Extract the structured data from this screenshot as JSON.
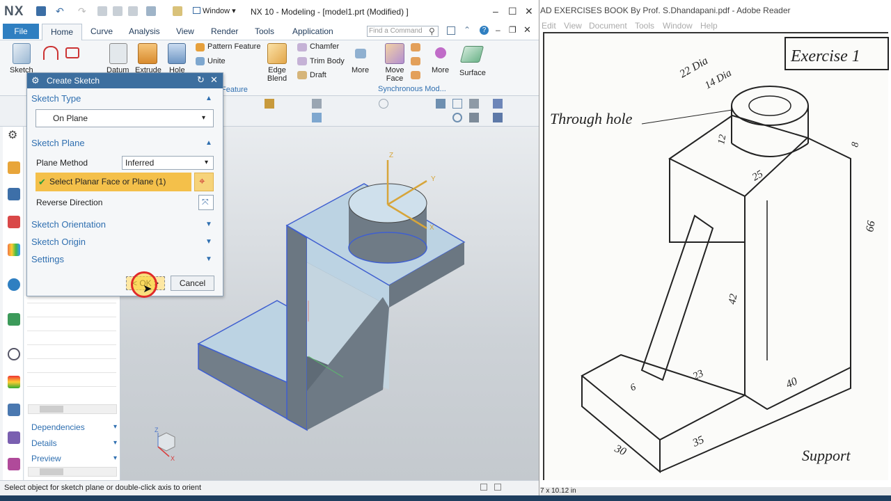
{
  "nx": {
    "logo": "NX",
    "window_title": "NX 10 - Modeling - [model1.prt (Modified) ]",
    "window_menu": "Window ▾",
    "find_command_placeholder": "Find a Command",
    "tabs": [
      "File",
      "Home",
      "Curve",
      "Analysis",
      "View",
      "Render",
      "Tools",
      "Application"
    ],
    "ribbon": {
      "sketch": "Sketch",
      "datum": "Datum",
      "extrude": "Extrude",
      "hole": "Hole",
      "pattern_feature": "Pattern Feature",
      "unite": "Unite",
      "edge_blend": "Edge Blend",
      "chamfer": "Chamfer",
      "trim_body": "Trim Body",
      "draft": "Draft",
      "more1": "More",
      "move_face": "Move Face",
      "more2": "More",
      "surface": "Surface",
      "group_feature": "Feature",
      "group_sync": "Synchronous Mod..."
    },
    "dialog": {
      "title": "Create Sketch",
      "sketch_type_header": "Sketch Type",
      "sketch_type_value": "On Plane",
      "sketch_plane_header": "Sketch Plane",
      "plane_method_label": "Plane Method",
      "plane_method_value": "Inferred",
      "select_face_label": "Select Planar Face or Plane (1)",
      "reverse_direction_label": "Reverse Direction",
      "sketch_orientation": "Sketch Orientation",
      "sketch_origin": "Sketch Origin",
      "settings": "Settings",
      "ok_label": "< OK >",
      "cancel_label": "Cancel"
    },
    "navigator": {
      "dependencies": "Dependencies",
      "details": "Details",
      "preview": "Preview"
    },
    "status_text": "Select object for sketch plane or double-click axis to orient",
    "axes": {
      "z": "Z",
      "y": "Y",
      "x": "X"
    }
  },
  "pdf": {
    "title": "AD EXERCISES BOOK By Prof. S.Dhandapani.pdf - Adobe Reader",
    "menu": [
      "Edit",
      "View",
      "Document",
      "Tools",
      "Window",
      "Help"
    ],
    "page_size": "7 x 10.12 in",
    "drawing": {
      "exercise_title": "Exercise 1",
      "through_hole": "Through hole",
      "support": "Support",
      "dim_22dia": "22 Dia",
      "dim_14dia": "14 Dia",
      "dim_12": "12",
      "dim_8": "8",
      "dim_25": "25",
      "dim_66": "66",
      "dim_42": "42",
      "dim_23": "23",
      "dim_6": "6",
      "dim_40": "40",
      "dim_30": "30",
      "dim_35": "35"
    }
  },
  "colors": {
    "nx_blue": "#2f7fc1",
    "dialog_title": "#3d6f9f",
    "selection_yellow": "#f4c04a",
    "model_face": "#bcd3e3",
    "model_side": "#6d7a86"
  }
}
